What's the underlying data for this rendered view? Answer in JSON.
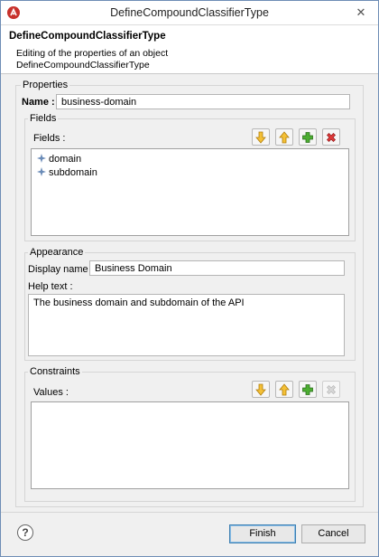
{
  "window": {
    "title": "DefineCompoundClassifierType"
  },
  "header": {
    "title": "DefineCompoundClassifierType",
    "description_line1": "Editing of the properties of an object",
    "description_line2": "DefineCompoundClassifierType"
  },
  "properties": {
    "group_title": "Properties",
    "name_label": "Name :",
    "name_value": "business-domain"
  },
  "fields": {
    "group_title": "Fields",
    "list_label": "Fields :",
    "items": [
      {
        "label": "domain",
        "icon": "field-icon"
      },
      {
        "label": "subdomain",
        "icon": "field-icon"
      }
    ],
    "toolbar": [
      "move-down-icon",
      "move-up-icon",
      "add-icon",
      "delete-icon"
    ]
  },
  "appearance": {
    "group_title": "Appearance",
    "display_name_label": "Display name :",
    "display_name_value": "Business Domain",
    "help_text_label": "Help text :",
    "help_text_value": "The business domain and subdomain of the API"
  },
  "constraints": {
    "group_title": "Constraints",
    "values_label": "Values :",
    "toolbar": [
      "move-down-icon",
      "move-up-icon",
      "add-icon",
      "delete-icon-disabled"
    ]
  },
  "footer": {
    "help_icon": "?",
    "finish_label": "Finish",
    "cancel_label": "Cancel"
  },
  "colors": {
    "accent": "#3c7fb1",
    "arrow": "#e8a818",
    "add": "#3a9a2a",
    "delete": "#cc2a2a"
  }
}
